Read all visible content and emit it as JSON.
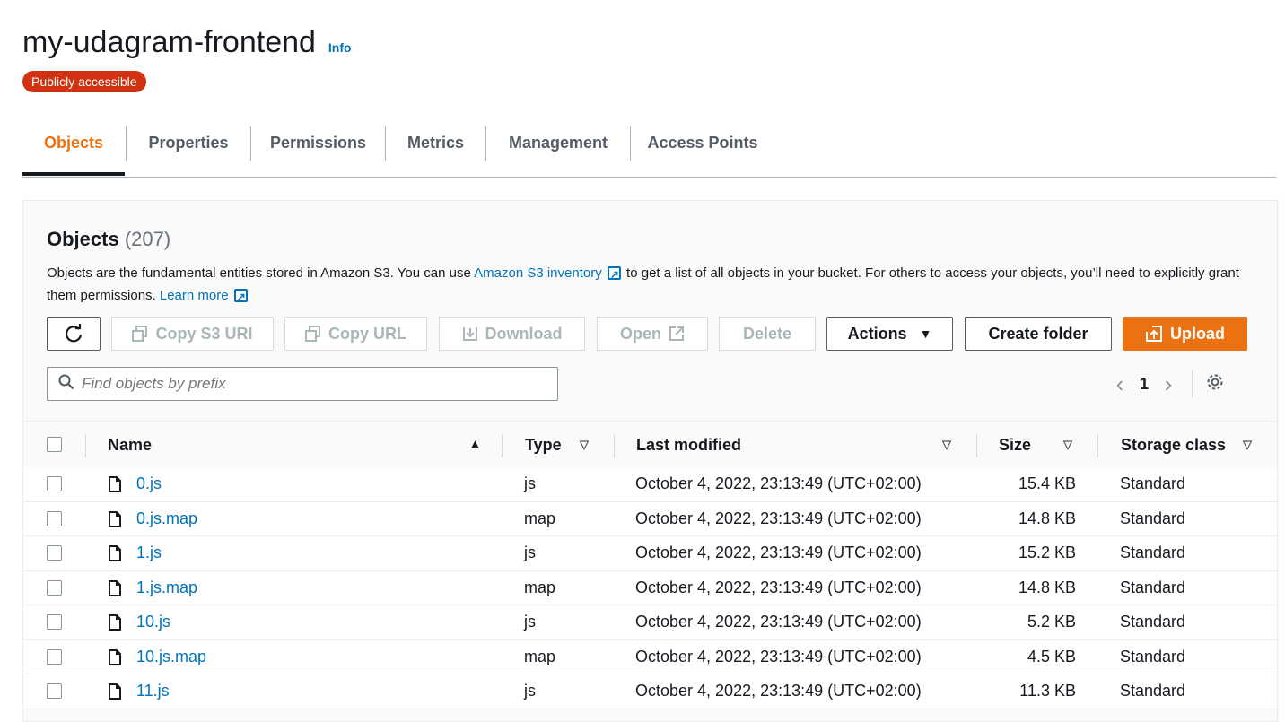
{
  "header": {
    "title": "my-udagram-frontend",
    "info_label": "Info",
    "badge": "Publicly accessible"
  },
  "tabs": [
    {
      "label": "Objects"
    },
    {
      "label": "Properties"
    },
    {
      "label": "Permissions"
    },
    {
      "label": "Metrics"
    },
    {
      "label": "Management"
    },
    {
      "label": "Access Points"
    }
  ],
  "objects": {
    "title": "Objects",
    "count": "(207)",
    "desc_1": "Objects are the fundamental entities stored in Amazon S3. You can use ",
    "inventory_link": "Amazon S3 inventory",
    "desc_2": " to get a list of all objects in your bucket. For others to access your objects, you’ll need to explicitly grant them permissions. ",
    "learn_more": "Learn more"
  },
  "toolbar": {
    "copy_s3_uri": "Copy S3 URI",
    "copy_url": "Copy URL",
    "download": "Download",
    "open": "Open",
    "delete": "Delete",
    "actions": "Actions",
    "create_folder": "Create folder",
    "upload": "Upload"
  },
  "search": {
    "placeholder": "Find objects by prefix"
  },
  "pagination": {
    "page": "1"
  },
  "table": {
    "columns": [
      "Name",
      "Type",
      "Last modified",
      "Size",
      "Storage class"
    ],
    "rows": [
      {
        "name": "0.js",
        "type": "js",
        "modified": "October 4, 2022, 23:13:49 (UTC+02:00)",
        "size": "15.4 KB",
        "class": "Standard"
      },
      {
        "name": "0.js.map",
        "type": "map",
        "modified": "October 4, 2022, 23:13:49 (UTC+02:00)",
        "size": "14.8 KB",
        "class": "Standard"
      },
      {
        "name": "1.js",
        "type": "js",
        "modified": "October 4, 2022, 23:13:49 (UTC+02:00)",
        "size": "15.2 KB",
        "class": "Standard"
      },
      {
        "name": "1.js.map",
        "type": "map",
        "modified": "October 4, 2022, 23:13:49 (UTC+02:00)",
        "size": "14.8 KB",
        "class": "Standard"
      },
      {
        "name": "10.js",
        "type": "js",
        "modified": "October 4, 2022, 23:13:49 (UTC+02:00)",
        "size": "5.2 KB",
        "class": "Standard"
      },
      {
        "name": "10.js.map",
        "type": "map",
        "modified": "October 4, 2022, 23:13:49 (UTC+02:00)",
        "size": "4.5 KB",
        "class": "Standard"
      },
      {
        "name": "11.js",
        "type": "js",
        "modified": "October 4, 2022, 23:13:49 (UTC+02:00)",
        "size": "11.3 KB",
        "class": "Standard"
      }
    ]
  },
  "colors": {
    "accent": "#ec7211",
    "link": "#0073bb",
    "badge": "#d13212"
  }
}
